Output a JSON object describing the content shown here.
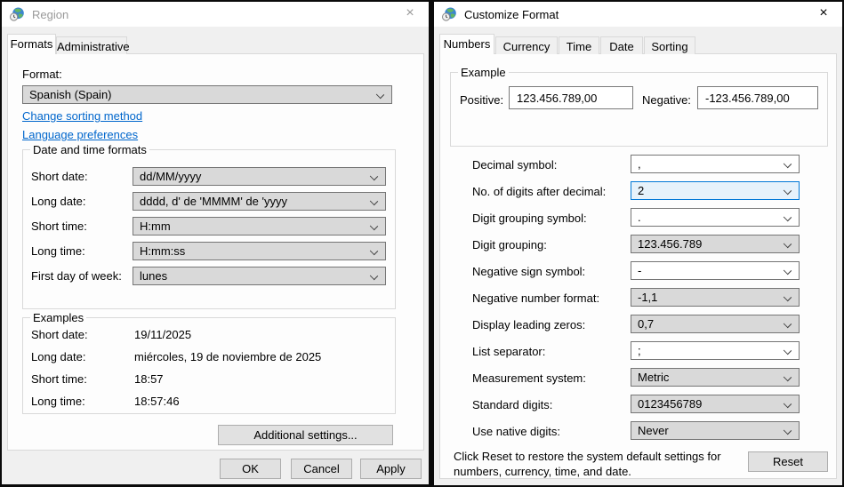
{
  "icons": {
    "close": "×"
  },
  "colors": {
    "accent": "#0078d7",
    "link": "#0066cc",
    "titlebar": "#ffffff",
    "dialog_bg": "#f0f0f0",
    "page_bg": "#fdfdfd",
    "focus_fill": "#e6f2fb"
  },
  "region_dialog": {
    "title": "Region",
    "tabs": [
      {
        "label": "Formats"
      },
      {
        "label": "Administrative"
      }
    ],
    "format_label": "Format:",
    "format_value": "Spanish (Spain)",
    "links": [
      {
        "label": "Change sorting method"
      },
      {
        "label": "Language preferences"
      }
    ],
    "datetime_group": {
      "title": "Date and time formats",
      "rows": [
        {
          "label": "Short date:",
          "value": "dd/MM/yyyy"
        },
        {
          "label": "Long date:",
          "value": "dddd, d' de 'MMMM' de 'yyyy"
        },
        {
          "label": "Short time:",
          "value": "H:mm"
        },
        {
          "label": "Long time:",
          "value": "H:mm:ss"
        },
        {
          "label": "First day of week:",
          "value": "lunes"
        }
      ]
    },
    "examples_group": {
      "title": "Examples",
      "rows": [
        {
          "label": "Short date:",
          "value": "19/11/2025"
        },
        {
          "label": "Long date:",
          "value": "miércoles, 19 de noviembre de 2025"
        },
        {
          "label": "Short time:",
          "value": "18:57"
        },
        {
          "label": "Long time:",
          "value": "18:57:46"
        }
      ]
    },
    "additional_settings_button": "Additional settings...",
    "ok_button": "OK",
    "cancel_button": "Cancel",
    "apply_button": "Apply"
  },
  "customize_dialog": {
    "title": "Customize Format",
    "tabs": [
      {
        "label": "Numbers"
      },
      {
        "label": "Currency"
      },
      {
        "label": "Time"
      },
      {
        "label": "Date"
      },
      {
        "label": "Sorting"
      }
    ],
    "example_group": {
      "title": "Example",
      "positive_label": "Positive:",
      "positive_value": "123.456.789,00",
      "negative_label": "Negative:",
      "negative_value": "-123.456.789,00"
    },
    "settings": [
      {
        "label": "Decimal symbol:",
        "value": ","
      },
      {
        "label": "No. of digits after decimal:",
        "value": "2"
      },
      {
        "label": "Digit grouping symbol:",
        "value": "."
      },
      {
        "label": "Digit grouping:",
        "value": "123.456.789"
      },
      {
        "label": "Negative sign symbol:",
        "value": "-"
      },
      {
        "label": "Negative number format:",
        "value": "-1,1"
      },
      {
        "label": "Display leading zeros:",
        "value": "0,7"
      },
      {
        "label": "List separator:",
        "value": ";"
      },
      {
        "label": "Measurement system:",
        "value": "Metric"
      },
      {
        "label": "Standard digits:",
        "value": "0123456789"
      },
      {
        "label": "Use native digits:",
        "value": "Never"
      }
    ],
    "reset_note": "Click Reset to restore the system default settings for numbers, currency, time, and date.",
    "reset_button": "Reset"
  }
}
